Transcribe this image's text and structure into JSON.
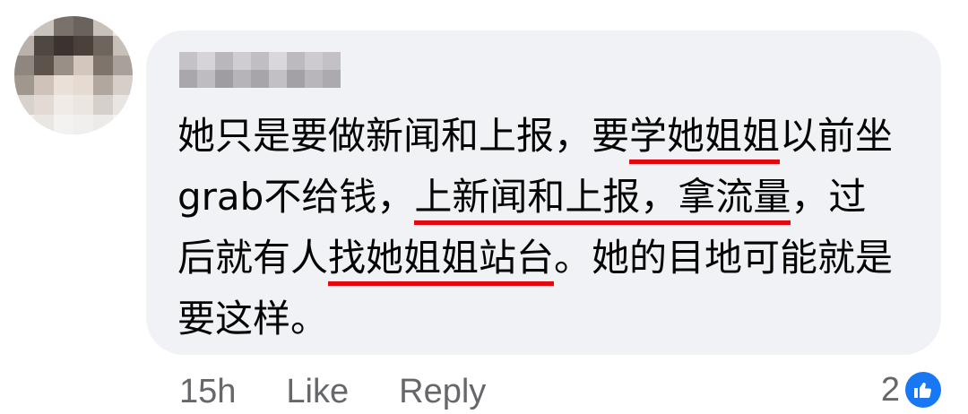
{
  "comment": {
    "lines": [
      [
        {
          "text": "她只是要做新闻和上报，要",
          "highlight": false
        },
        {
          "text": "学她姐姐",
          "highlight": true
        },
        {
          "text": "以前坐",
          "highlight": false
        }
      ],
      [
        {
          "text": "grab不给钱，",
          "highlight": false
        },
        {
          "text": "上新闻和上报，拿流量",
          "highlight": true
        },
        {
          "text": "，过",
          "highlight": false
        }
      ],
      [
        {
          "text": "后就有人",
          "highlight": false
        },
        {
          "text": "找她姐姐站台",
          "highlight": true
        },
        {
          "text": "。她的目地可能就是",
          "highlight": false
        }
      ],
      [
        {
          "text": "要这样。",
          "highlight": false
        }
      ]
    ],
    "highlight_color": "#e5060f"
  },
  "footer": {
    "time": "15h",
    "like_label": "Like",
    "reply_label": "Reply",
    "reaction_count": "2",
    "reaction_icon": "thumbs-up-icon"
  },
  "colors": {
    "bubble": "#f0f2f5",
    "text": "#050505",
    "meta": "#65676b",
    "like_blue": "#1877f2"
  }
}
